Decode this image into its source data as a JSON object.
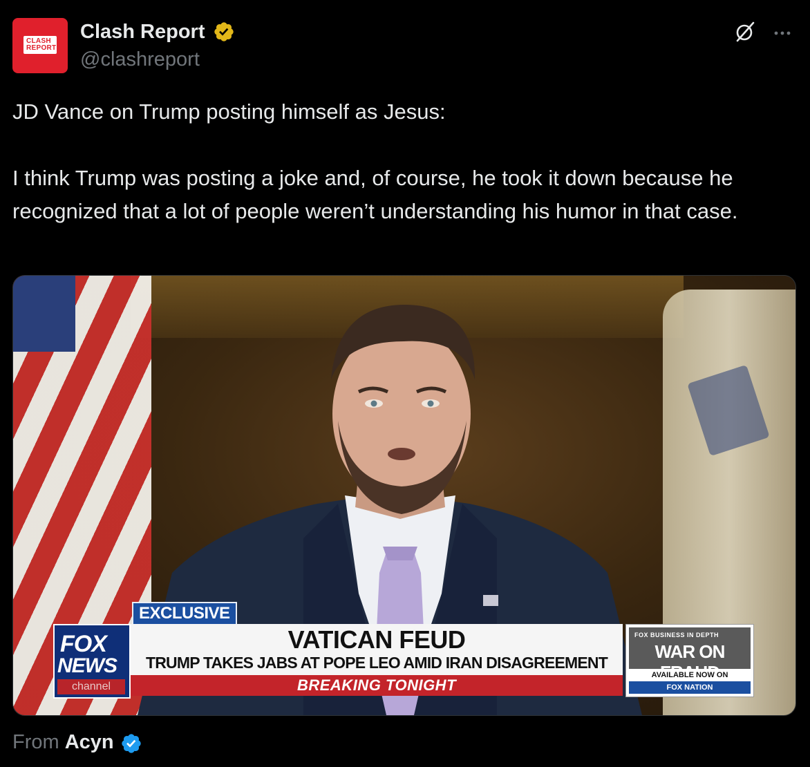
{
  "author": {
    "avatar_line1": "CLASH",
    "avatar_line2": "REPORT",
    "display_name": "Clash Report",
    "handle": "@clashreport",
    "verified_badge": "gold-verified-badge-icon"
  },
  "actions": {
    "grok_icon": "grok-icon",
    "more_icon": "more-options-icon"
  },
  "tweet": {
    "line1": "JD Vance on Trump posting himself as Jesus:",
    "line2": "I think Trump was posting a joke and, of course, he took it down because he recognized that a lot of people weren’t understanding his humor in that case."
  },
  "media": {
    "exclusive": "EXCLUSIVE",
    "network_line1": "FOX",
    "network_line2": "NEWS",
    "network_line3": "channel",
    "headline": "VATICAN FEUD",
    "subhead": "TRUMP TAKES JABS AT POPE LEO AMID IRAN DISAGREEMENT",
    "breaking": "BREAKING TONIGHT",
    "promo_brand": "FOX BUSINESS IN DEPTH",
    "promo_title": "WAR ON FRAUD",
    "promo_available": "AVAILABLE NOW ON",
    "promo_nation": "FOX NATION"
  },
  "footer": {
    "from_label": "From",
    "source": "Acyn",
    "source_badge": "blue-verified-badge-icon"
  },
  "colors": {
    "background": "#000000",
    "text": "#e7e9ea",
    "secondary_text": "#71767b",
    "gold_badge": "#e2b719",
    "blue_badge": "#1d9bf0",
    "avatar_red": "#e0202c",
    "fox_blue": "#1b4fa0",
    "breaking_red": "#c3242a"
  }
}
